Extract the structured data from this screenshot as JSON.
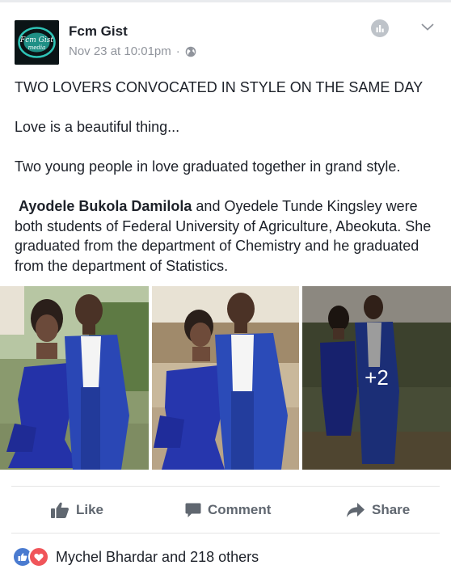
{
  "post": {
    "page_name": "Fcm Gist",
    "timestamp": "Nov 23 at 10:01pm",
    "separator": "·",
    "avatar_text_line1": "Fcm Gist",
    "avatar_text_line2": "media",
    "headline": "TWO LOVERS CONVOCATED IN STYLE ON THE SAME DAY",
    "line1": "Love is a beautiful thing...",
    "line2": "Two young people in love graduated together in grand style.",
    "name_bold": "Ayodele Bukola Damilola",
    "paragraph_rest": " and Oyedele Tunde Kingsley were both students of Federal University of Agriculture, Abeokuta. She graduated from the department of Chemistry and he graduated from the department of Statistics."
  },
  "photos": {
    "more_count": "+2"
  },
  "actions": {
    "like": "Like",
    "comment": "Comment",
    "share": "Share"
  },
  "reactions": {
    "text": "Mychel Bhardar and 218 others"
  },
  "icons": {
    "globe": "globe-icon",
    "stats": "stats-icon",
    "menu": "chevron-down-icon",
    "like": "thumbs-up-icon",
    "comment": "comment-icon",
    "share": "share-arrow-icon"
  },
  "colors": {
    "like_reaction": "#4a7bd0",
    "love_reaction": "#f0555a",
    "action_text": "#606770",
    "meta_text": "#90949c"
  }
}
